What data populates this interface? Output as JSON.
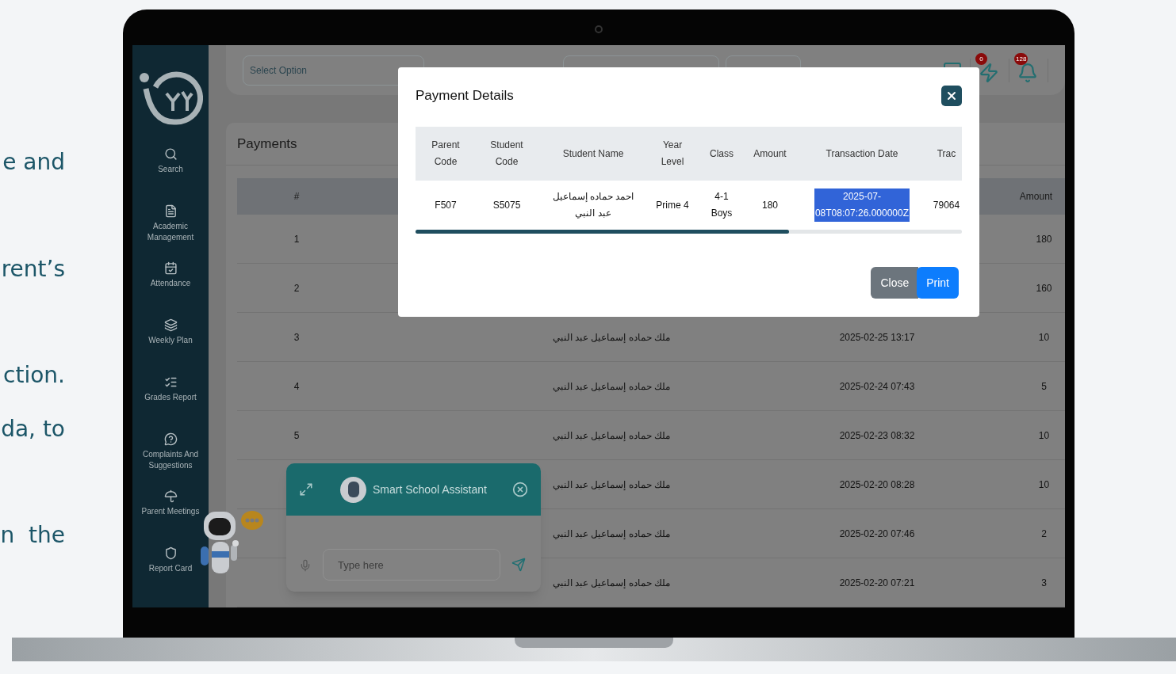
{
  "side_text": [
    "e and",
    "rent’s",
    "ction.",
    "da, to",
    "n  the"
  ],
  "sidebar": {
    "items": [
      {
        "label": "Search"
      },
      {
        "label": "Academic Management"
      },
      {
        "label": "Attendance"
      },
      {
        "label": "Weekly Plan"
      },
      {
        "label": "Grades Report"
      },
      {
        "label": "Complaints And Suggestions"
      },
      {
        "label": "Parent Meetings"
      },
      {
        "label": "Report Card"
      }
    ]
  },
  "top_bar": {
    "select": {
      "placeholder": "Select Option"
    },
    "badges": [
      {
        "count": "0"
      },
      {
        "count": "128"
      }
    ]
  },
  "payments": {
    "title": "Payments",
    "columns": {
      "number": "#",
      "amount": "Amount"
    },
    "rows": [
      {
        "number": "1",
        "amount": "180"
      },
      {
        "number": "2",
        "amount": "160"
      },
      {
        "number": "3",
        "student_name": "ملك حماده إسماعيل عبد النبي",
        "date": "2025-02-25 13:17",
        "amount": "10"
      },
      {
        "number": "4",
        "student_name": "ملك حماده إسماعيل عبد النبي",
        "date": "2025-02-24 07:43",
        "amount": "5"
      },
      {
        "number": "5",
        "student_name": "ملك حماده إسماعيل عبد النبي",
        "date": "2025-02-23 08:32",
        "amount": "10"
      },
      {
        "student_name": "ملك حماده إسماعيل عبد النبي",
        "date": "2025-02-20 08:28",
        "amount": "10"
      },
      {
        "student_name": "ملك حماده إسماعيل عبد النبي",
        "date": "2025-02-20 07:46",
        "amount": "2"
      },
      {
        "student_name": "ملك حماده إسماعيل عبد النبي",
        "date": "2025-02-20 07:21",
        "amount": "3"
      }
    ]
  },
  "modal": {
    "title": "Payment Details",
    "columns": [
      "Parent Code",
      "Student Code",
      "Student Name",
      "Year Level",
      "Class",
      "Amount",
      "Transaction Date",
      "Trac"
    ],
    "row": [
      {
        "text": "F507",
        "highlighted": false
      },
      {
        "text": "S5075",
        "highlighted": false
      },
      {
        "text": "احمد حماده إسماعيل عبد النبي",
        "highlighted": false
      },
      {
        "text": "Prime 4",
        "highlighted": false
      },
      {
        "text": "4-1 Boys",
        "highlighted": false
      },
      {
        "text": "180",
        "highlighted": false
      },
      {
        "text": "2025-07-08T08:07:26.000000Z",
        "highlighted": true
      },
      {
        "text": "79064",
        "highlighted": false
      }
    ],
    "buttons": [
      "Close",
      "Print"
    ]
  },
  "chat": {
    "title": "Smart School Assistant",
    "input": {
      "placeholder": "Type here"
    }
  }
}
